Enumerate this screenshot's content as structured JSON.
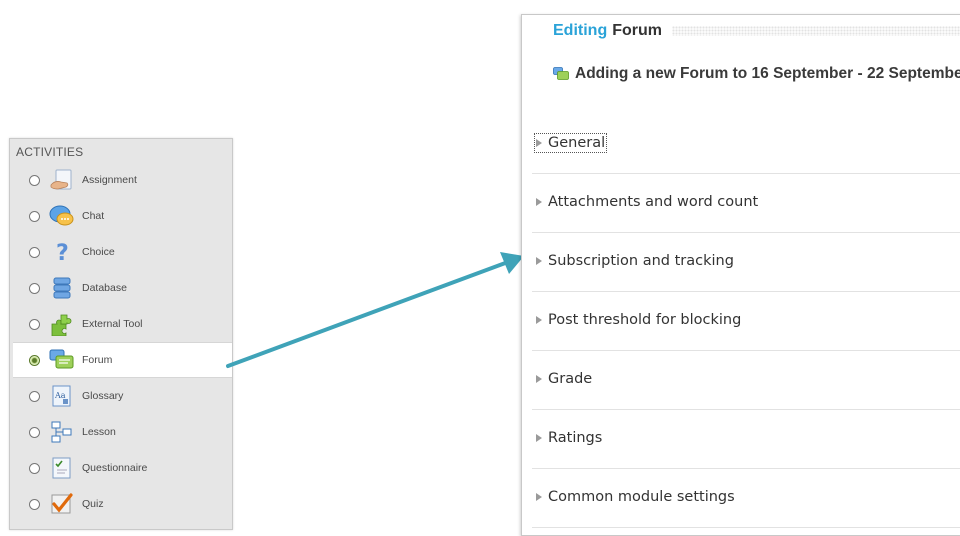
{
  "activities": {
    "header": "ACTIVITIES",
    "items": [
      {
        "label": "Assignment",
        "icon": "assignment-icon",
        "selected": false
      },
      {
        "label": "Chat",
        "icon": "chat-icon",
        "selected": false
      },
      {
        "label": "Choice",
        "icon": "question-mark-icon",
        "selected": false
      },
      {
        "label": "Database",
        "icon": "database-icon",
        "selected": false
      },
      {
        "label": "External Tool",
        "icon": "puzzle-icon",
        "selected": false
      },
      {
        "label": "Forum",
        "icon": "forum-icon",
        "selected": true
      },
      {
        "label": "Glossary",
        "icon": "glossary-icon",
        "selected": false
      },
      {
        "label": "Lesson",
        "icon": "lesson-icon",
        "selected": false
      },
      {
        "label": "Questionnaire",
        "icon": "questionnaire-icon",
        "selected": false
      },
      {
        "label": "Quiz",
        "icon": "checkmark-icon",
        "selected": false
      }
    ]
  },
  "editing": {
    "title_accent": "Editing",
    "title_rest": "Forum",
    "subtitle": "Adding a new Forum to 16 September - 22 Septembe",
    "sections": [
      {
        "label": "General"
      },
      {
        "label": "Attachments and word count"
      },
      {
        "label": "Subscription and tracking"
      },
      {
        "label": "Post threshold for blocking"
      },
      {
        "label": "Grade"
      },
      {
        "label": "Ratings"
      },
      {
        "label": "Common module settings"
      }
    ]
  },
  "colors": {
    "accent": "#2aa3d8",
    "arrow": "#3fa3b8",
    "panel_bg": "#e6e6e6"
  }
}
